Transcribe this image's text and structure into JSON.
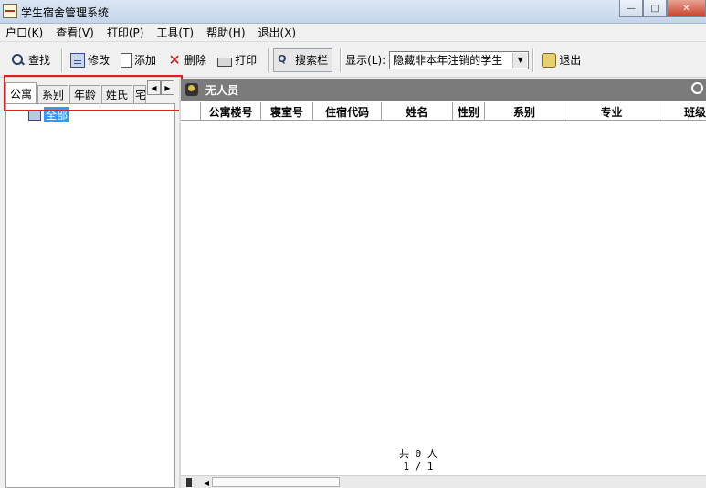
{
  "window": {
    "title": "学生宿舍管理系统"
  },
  "menu": [
    "户口(K)",
    "查看(V)",
    "打印(P)",
    "工具(T)",
    "帮助(H)",
    "退出(X)"
  ],
  "toolbar": {
    "find": "查找",
    "edit": "修改",
    "add": "添加",
    "delete": "删除",
    "print": "打印",
    "search_bar": "搜索栏",
    "display_label": "显示(L):",
    "display_value": "隐藏非本年注销的学生",
    "exit": "退出"
  },
  "tabs": [
    "公寓",
    "系别",
    "年龄",
    "姓氏",
    "宅"
  ],
  "tree": {
    "root_label": "全部"
  },
  "panel": {
    "title": "无人员"
  },
  "columns": [
    "公寓楼号",
    "寝室号",
    "住宿代码",
    "姓名",
    "性别",
    "系别",
    "专业",
    "班级"
  ],
  "footer": {
    "total": "共 0 人",
    "page": "1 / 1"
  },
  "colors": {
    "header_bg": "#7b7b7b",
    "tree_selection": "#3399ff",
    "highlight_border": "#e02020"
  },
  "icons": [
    "app-icon",
    "search-icon",
    "edit-icon",
    "add-icon",
    "delete-icon",
    "print-icon",
    "search-bar-icon",
    "exit-icon",
    "people-icon",
    "folder-tree-icon"
  ]
}
